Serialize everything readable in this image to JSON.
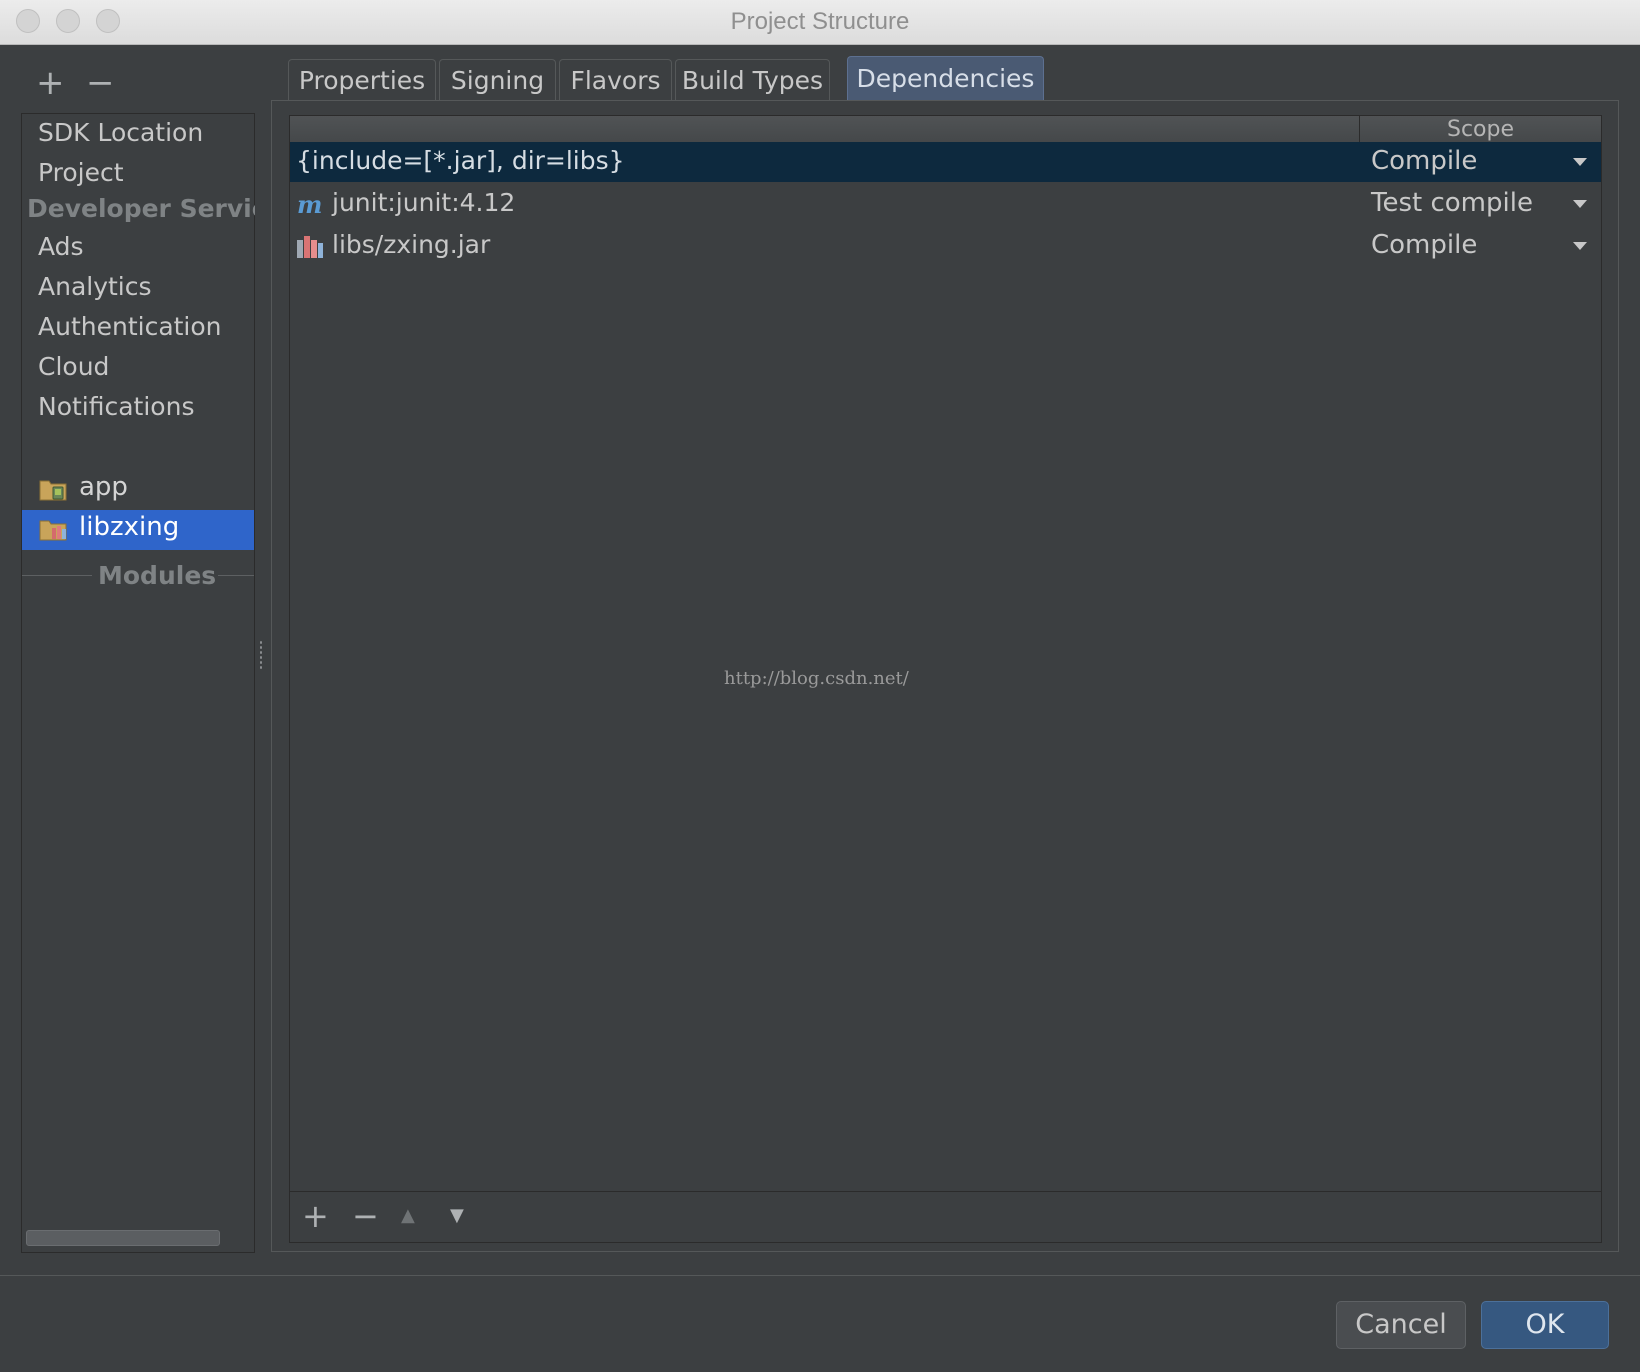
{
  "window": {
    "title": "Project Structure"
  },
  "sidebar": {
    "toolbar": {
      "add": "+",
      "remove": "−"
    },
    "items": [
      {
        "label": "SDK Location"
      },
      {
        "label": "Project"
      }
    ],
    "developer_services_header": "Developer Servic",
    "services": [
      {
        "label": "Ads"
      },
      {
        "label": "Analytics"
      },
      {
        "label": "Authentication"
      },
      {
        "label": "Cloud"
      },
      {
        "label": "Notifications"
      }
    ],
    "modules_header": "Modules",
    "modules": [
      {
        "label": "app",
        "icon": "android-module-icon",
        "selected": false
      },
      {
        "label": "libzxing",
        "icon": "library-module-icon",
        "selected": true
      }
    ]
  },
  "tabs": [
    {
      "label": "Properties",
      "active": false
    },
    {
      "label": "Signing",
      "active": false
    },
    {
      "label": "Flavors",
      "active": false
    },
    {
      "label": "Build Types",
      "active": false
    },
    {
      "label": "Dependencies",
      "active": true
    }
  ],
  "dependencies": {
    "columns": {
      "name": "",
      "scope": "Scope"
    },
    "rows": [
      {
        "name": "{include=[*.jar], dir=libs}",
        "scope": "Compile",
        "icon": "none",
        "selected": true
      },
      {
        "name": "junit:junit:4.12",
        "scope": "Test compile",
        "icon": "maven-icon",
        "selected": false
      },
      {
        "name": "libs/zxing.jar",
        "scope": "Compile",
        "icon": "jar-library-icon",
        "selected": false
      }
    ],
    "toolbar": {
      "add": "+",
      "remove": "−",
      "up": "▲",
      "down": "▼"
    }
  },
  "watermark": "http://blog.csdn.net/",
  "buttons": {
    "cancel": "Cancel",
    "ok": "OK"
  },
  "colors": {
    "background": "#3c3f41",
    "selection_sidebar": "#2f65ca",
    "selection_table": "#0d293e",
    "active_tab": "#4a5a73",
    "ok_button": "#365880"
  }
}
